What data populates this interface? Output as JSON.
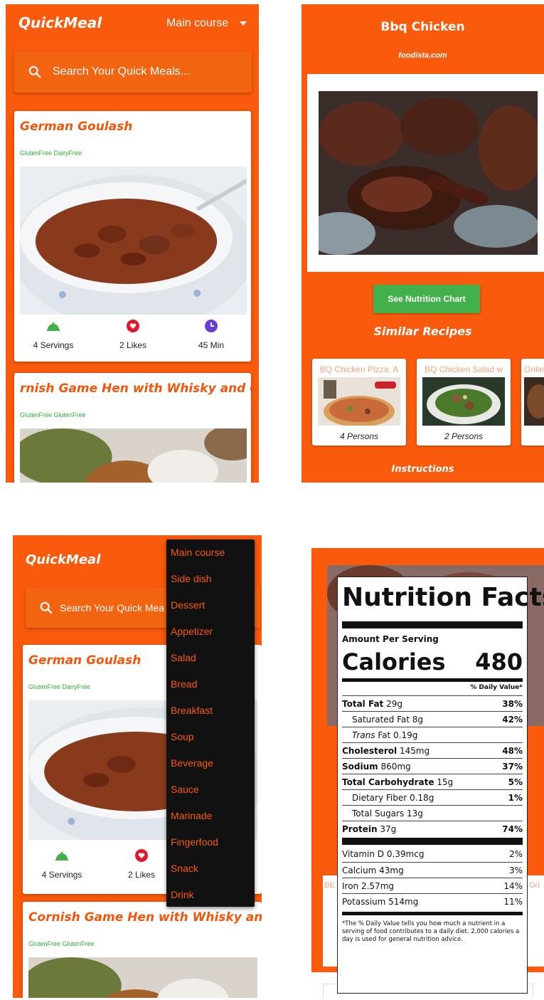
{
  "list_screen": {
    "brand": "QuickMeal",
    "course_select": "Main course",
    "search_placeholder": "Search Your Quick Meals...",
    "cards": [
      {
        "title": "German Goulash",
        "tags": "GlutenFree DairyFree",
        "servings": "4 Servings",
        "likes": "2 Likes",
        "time": "45 Min"
      },
      {
        "title": "rnish Game Hen with Whisky and C",
        "tags": "GlutenFree GlutenFree"
      }
    ],
    "stat_icons": [
      "cloche-icon",
      "heart-icon",
      "clock-icon"
    ],
    "colors": {
      "accent": "#f95a0c",
      "tag": "#2fae3a",
      "cloche": "#43b14b",
      "heart": "#e0182c",
      "clock": "#6a3bd8"
    }
  },
  "dropdown_screen": {
    "brand": "QuickMeal",
    "search_placeholder": "Search Your Quick Mea",
    "options": [
      "Main course",
      "Side dish",
      "Dessert",
      "Appetizer",
      "Salad",
      "Bread",
      "Breakfast",
      "Soup",
      "Beverage",
      "Sauce",
      "Marinade",
      "Fingerfood",
      "Snack",
      "Drink"
    ],
    "cards": [
      {
        "title": "German Goulash",
        "tags": "GlutenFree DairyFree",
        "servings": "4 Servings",
        "likes": "2 Likes"
      },
      {
        "title": "Cornish Game Hen with Whisky an..",
        "tags": "GlutenFree GlutenFree"
      }
    ]
  },
  "detail_screen": {
    "title": "Bbq Chicken",
    "source": "foodista.com",
    "nutrition_button": "See Nutrition Chart",
    "similar_heading": "Similar Recipes",
    "similar": [
      {
        "title": "BQ Chicken Pizza: A",
        "persons": "4 Persons"
      },
      {
        "title": "BQ Chicken Salad w",
        "persons": "2 Persons"
      },
      {
        "title": "Grille",
        "persons": ""
      }
    ],
    "instructions_heading": "Instructions"
  },
  "nutrition_screen": {
    "title": "Nutrition Facts",
    "amount_per_serving": "Amount Per Serving",
    "calories_label": "Calories",
    "calories_value": "480",
    "daily_value_header": "% Daily Value*",
    "side_left": "BE",
    "side_right": "Gri",
    "rows": [
      {
        "name": "Total Fat 29g",
        "pct": "38%"
      },
      {
        "name": "Saturated Fat 8g",
        "pct": "42%"
      },
      {
        "name": "Trans Fat 0.19g",
        "pct": ""
      },
      {
        "name": "Cholesterol 145mg",
        "pct": "48%"
      },
      {
        "name": "Sodium 860mg",
        "pct": "37%"
      },
      {
        "name": "Total Carbohydrate 15g",
        "pct": "5%"
      },
      {
        "name": "Dietary Fiber 0.18g",
        "pct": "1%"
      },
      {
        "name": "Total Sugars 13g",
        "pct": ""
      },
      {
        "name": "Protein 37g",
        "pct": "74%"
      },
      {
        "name": "Vitamin D 0.39mcg",
        "pct": "2%"
      },
      {
        "name": "Calcium 43mg",
        "pct": "3%"
      },
      {
        "name": "Iron 2.57mg",
        "pct": "14%"
      },
      {
        "name": "Potassium 514mg",
        "pct": "11%"
      }
    ],
    "footnote": "*The % Daily Value tells you how much a nutrient in a serving of food contributes to a daily diet. 2,000 calories a day is used for general nutrition advice."
  }
}
